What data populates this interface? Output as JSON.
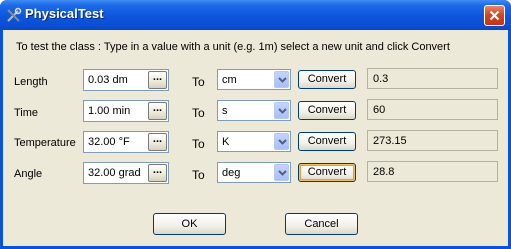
{
  "window": {
    "title": "PhysicalTest"
  },
  "instructions": "To test the class : Type in a value with a unit (e.g. 1m) select a new unit and click Convert",
  "rows": [
    {
      "label": "Length",
      "input": "0.03 dm",
      "ellipsis": "...",
      "to": "To",
      "unit": "cm",
      "button": "Convert",
      "result": "0.3"
    },
    {
      "label": "Time",
      "input": "1.00 min",
      "ellipsis": "...",
      "to": "To",
      "unit": "s",
      "button": "Convert",
      "result": "60"
    },
    {
      "label": "Temperature",
      "input": "32.00 °F",
      "ellipsis": "...",
      "to": "To",
      "unit": "K",
      "button": "Convert",
      "result": "273.15"
    },
    {
      "label": "Angle",
      "input": "32.00 grad",
      "ellipsis": "...",
      "to": "To",
      "unit": "deg",
      "button": "Convert",
      "result": "28.8"
    }
  ],
  "buttons": {
    "ok": "OK",
    "cancel": "Cancel"
  },
  "icons": {
    "app": "tools-icon",
    "close": "close-icon",
    "dropdown": "chevron-down-icon"
  },
  "colors": {
    "titlebar": "#0a52d6",
    "face": "#ece9d8",
    "close": "#d5451f",
    "focus": "#e5a033"
  }
}
